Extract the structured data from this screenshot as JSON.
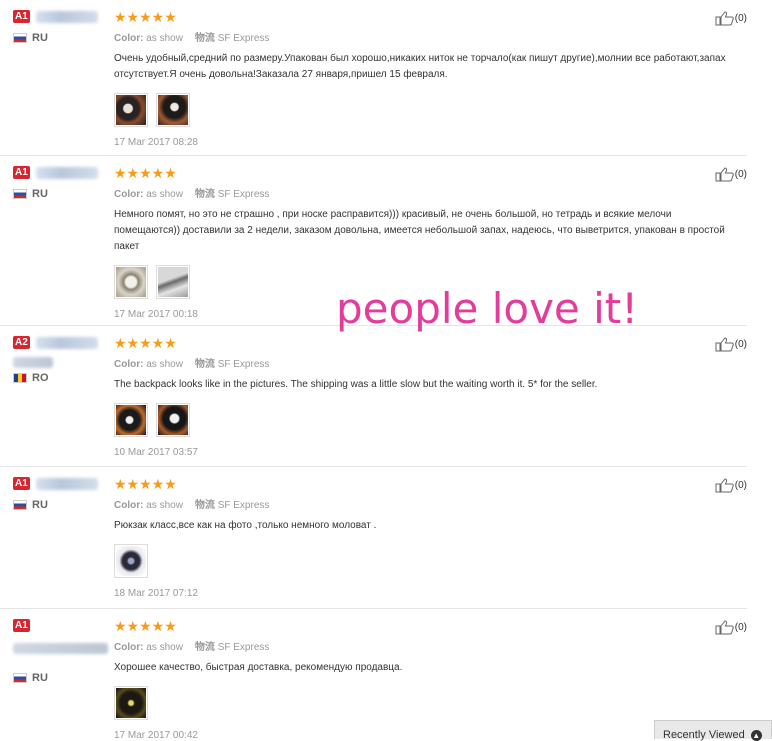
{
  "promo_text": "people love it!",
  "recently_viewed": "Recently Viewed",
  "reviews": [
    {
      "level": "A1",
      "country": "RU",
      "stars": "★★★★★",
      "color_label": "Color:",
      "color_value": "as show",
      "shipping_label": "物流",
      "shipping_value": "SF Express",
      "text": "Очень удобный,средний по размеру.Упакован был хорошо,никаких ниток не торчало(как пишут другие),молнии все работают,запах отсутствует.Я очень довольна!Заказала 27 января,пришел 15 февраля.",
      "date": "17 Mar 2017 08:28",
      "helpful": "(0)",
      "photos": 2
    },
    {
      "level": "A1",
      "country": "RU",
      "stars": "★★★★★",
      "color_label": "Color:",
      "color_value": "as show",
      "shipping_label": "物流",
      "shipping_value": "SF Express",
      "text": "Немного помят, но это не страшно , при носке расправится))) красивый, не очень большой, но тетрадь и всякие мелочи помещаются)) доставили за 2 недели, заказом довольна, имеется небольшой запах, надеюсь, что выветрится, упакован в простой пакет",
      "date": "17 Mar 2017 00:18",
      "helpful": "(0)",
      "photos": 2
    },
    {
      "level": "A2",
      "country": "RO",
      "stars": "★★★★★",
      "color_label": "Color:",
      "color_value": "as show",
      "shipping_label": "物流",
      "shipping_value": "SF Express",
      "text": "The backpack looks like in the pictures. The shipping was a little slow but the waiting worth it. 5* for the seller.",
      "date": "10 Mar 2017 03:57",
      "helpful": "(0)",
      "photos": 2
    },
    {
      "level": "A1",
      "country": "RU",
      "stars": "★★★★★",
      "color_label": "Color:",
      "color_value": "as show",
      "shipping_label": "物流",
      "shipping_value": "SF Express",
      "text": "Рюкзак класс,все как на фото ,только немного моловат .",
      "date": "18 Mar 2017 07:12",
      "helpful": "(0)",
      "photos": 1
    },
    {
      "level": "A1",
      "country": "RU",
      "stars": "★★★★★",
      "color_label": "Color:",
      "color_value": "as show",
      "shipping_label": "物流",
      "shipping_value": "SF Express",
      "text": "Хорошее качество, быстрая доставка, рекомендую продавца.",
      "date": "17 Mar 2017 00:42",
      "helpful": "(0)",
      "photos": 1
    }
  ]
}
